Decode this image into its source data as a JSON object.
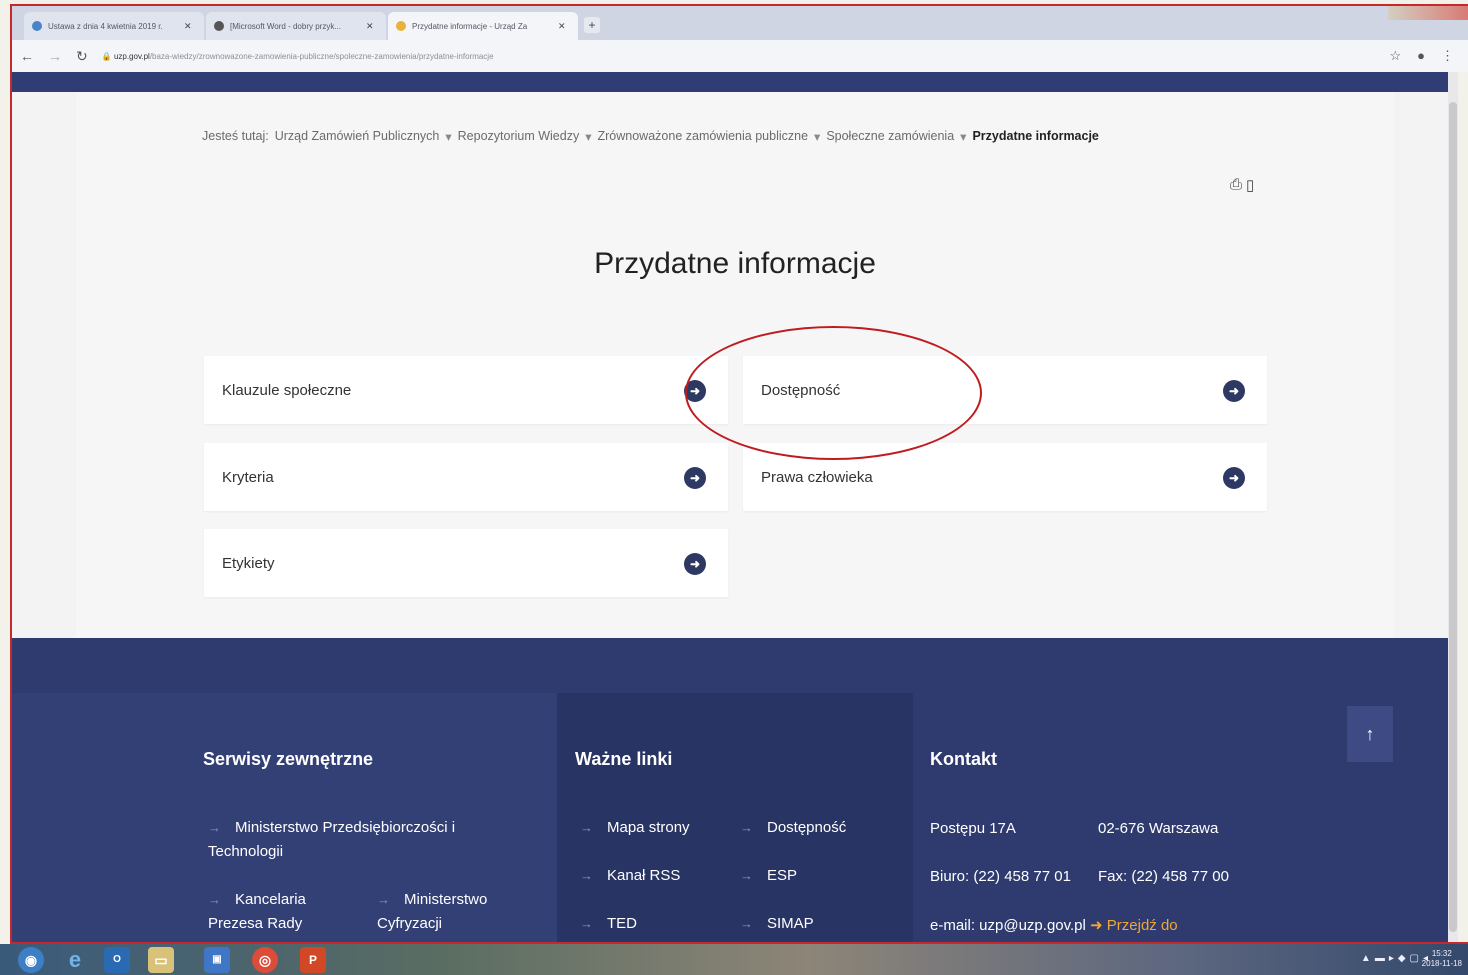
{
  "browser": {
    "tabs": [
      {
        "label": "Ustawa z dnia 4 kwietnia 2019 r."
      },
      {
        "label": "[Microsoft Word - dobry przyk..."
      },
      {
        "label": "Przydatne informacje - Urząd Za"
      }
    ],
    "url_host": "uzp.gov.pl",
    "url_path": "/baza-wiedzy/zrownowazone-zamowienia-publiczne/spoleczne-zamowienia/przydatne-informacje"
  },
  "breadcrumb": {
    "prefix": "Jesteś tutaj:",
    "items": [
      "Urząd Zamówień Publicznych",
      "Repozytorium Wiedzy",
      "Zrównoważone zamówienia publiczne",
      "Społeczne zamówienia"
    ],
    "current": "Przydatne informacje"
  },
  "page": {
    "title": "Przydatne informacje",
    "tiles": [
      {
        "label": "Klauzule społeczne"
      },
      {
        "label": "Dostępność"
      },
      {
        "label": "Kryteria"
      },
      {
        "label": "Prawa człowieka"
      },
      {
        "label": "Etykiety"
      }
    ]
  },
  "footer": {
    "col1_title": "Serwisy zewnętrzne",
    "col1_links": [
      "Ministerstwo Przedsiębiorczości i Technologii",
      "Kancelaria Prezesa Rady",
      "Ministerstwo Cyfryzacji"
    ],
    "col2_title": "Ważne linki",
    "col2_links": [
      "Mapa strony",
      "Dostępność",
      "Kanał RSS",
      "ESP",
      "TED",
      "SIMAP"
    ],
    "col3_title": "Kontakt",
    "address": "Postępu 17A",
    "city": "02-676 Warszawa",
    "phone": "Biuro: (22) 458 77 01",
    "fax": "Fax: (22) 458 77 00",
    "email": "e-mail: uzp@uzp.gov.pl",
    "goto": "Przejdź do"
  },
  "taskbar": {
    "clock_time": "15:32",
    "clock_date": "2018-11-18"
  },
  "colors": {
    "navy": "#2f3b6e",
    "arrow": "#2e3963",
    "highlight_ring": "#c01b1e",
    "link_orange": "#f0a63a"
  }
}
